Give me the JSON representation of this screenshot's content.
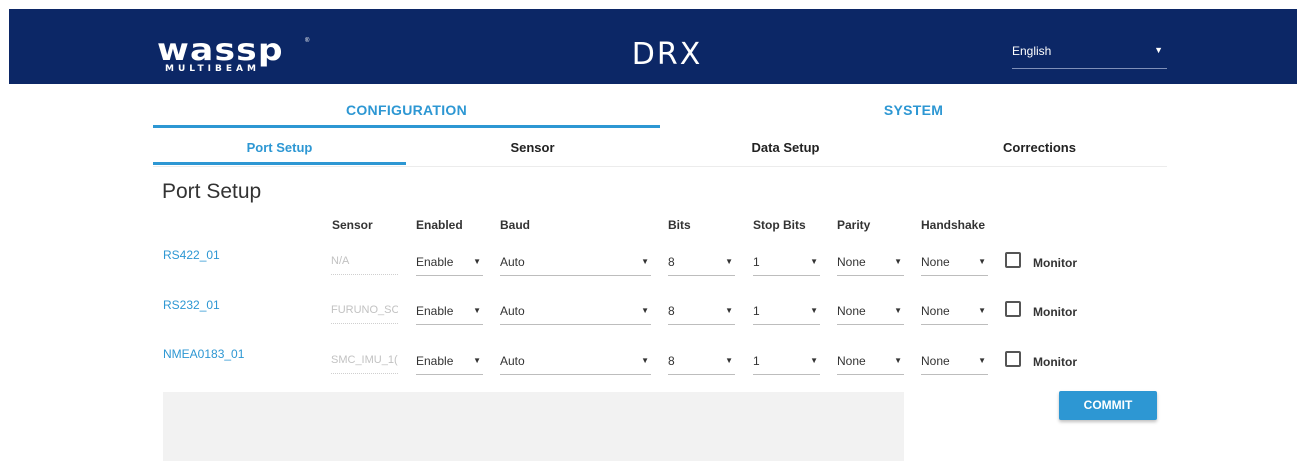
{
  "header": {
    "logo_main": "wassp",
    "logo_sub": "MULTIBEAM",
    "logo_reg": "®",
    "product": "DRX",
    "language": {
      "selected": "English",
      "icon": "triangle-down-icon"
    }
  },
  "main_tabs": [
    {
      "label": "CONFIGURATION",
      "active": true
    },
    {
      "label": "SYSTEM",
      "active": false
    }
  ],
  "sub_tabs": [
    {
      "label": "Port Setup",
      "active": true
    },
    {
      "label": "Sensor",
      "active": false
    },
    {
      "label": "Data Setup",
      "active": false
    },
    {
      "label": "Corrections",
      "active": false
    }
  ],
  "page_title": "Port Setup",
  "columns": {
    "sensor": "Sensor",
    "enabled": "Enabled",
    "baud": "Baud",
    "bits": "Bits",
    "stop_bits": "Stop Bits",
    "parity": "Parity",
    "handshake": "Handshake"
  },
  "rows": [
    {
      "port": "RS422_01",
      "sensor": "N/A",
      "enabled": "Enable",
      "baud": "Auto",
      "bits": "8",
      "stop_bits": "1",
      "parity": "None",
      "handshake": "None",
      "monitor_label": "Monitor",
      "monitor_checked": false
    },
    {
      "port": "RS232_01",
      "sensor": "FURUNO_SC",
      "enabled": "Enable",
      "baud": "Auto",
      "bits": "8",
      "stop_bits": "1",
      "parity": "None",
      "handshake": "None",
      "monitor_label": "Monitor",
      "monitor_checked": false
    },
    {
      "port": "NMEA0183_01",
      "sensor": "SMC_IMU_1(",
      "enabled": "Enable",
      "baud": "Auto",
      "bits": "8",
      "stop_bits": "1",
      "parity": "None",
      "handshake": "None",
      "monitor_label": "Monitor",
      "monitor_checked": false
    }
  ],
  "dropdown_arrow": "▼",
  "commit_label": "COMMIT",
  "colors": {
    "header_bg": "#0c2766",
    "accent": "#2d97d3"
  }
}
